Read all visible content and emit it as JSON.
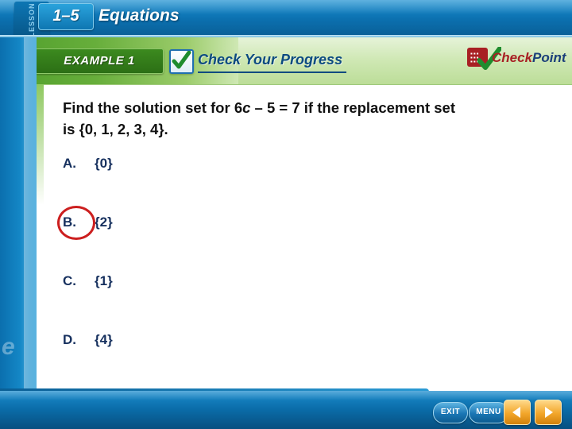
{
  "header": {
    "lesson_tab_label": "LESSON",
    "lesson_number": "1–5",
    "title": "Equations"
  },
  "subheader": {
    "example_label": "EXAMPLE 1",
    "check_icon": "checkmark-icon",
    "progress_title": "Check Your Progress",
    "checkpoint_logo": {
      "badge_icon": "grid-dots-icon",
      "tick_icon": "checkmark-icon",
      "text_primary": "Check",
      "text_secondary": "Point"
    }
  },
  "content": {
    "question_part1": "Find the solution set for 6",
    "question_var": "c",
    "question_part2": " – 5 = 7 if the replacement set is {0, 1, 2, 3, 4}.",
    "choices": [
      {
        "label": "A.",
        "value": "{0}",
        "selected": false
      },
      {
        "label": "B.",
        "value": "{2}",
        "selected": true
      },
      {
        "label": "C.",
        "value": "{1}",
        "selected": false
      },
      {
        "label": "D.",
        "value": "{4}",
        "selected": false
      }
    ],
    "answer_highlight_color": "#cc1f1f"
  },
  "watermark": "e",
  "footer": {
    "exit_label": "EXIT",
    "menu_label": "MENU",
    "prev_icon": "left-triangle-icon",
    "next_icon": "right-triangle-icon"
  }
}
